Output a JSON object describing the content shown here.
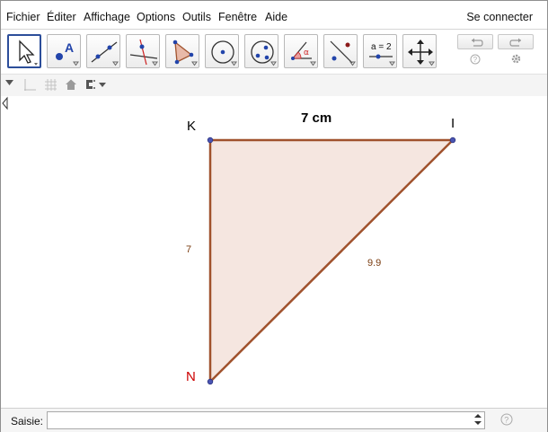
{
  "menu": {
    "items": [
      "Fichier",
      "Éditer",
      "Affichage",
      "Options",
      "Outils",
      "Fenêtre",
      "Aide"
    ],
    "login": "Se connecter"
  },
  "toolbar": {
    "tools": [
      {
        "name": "move-tool-icon",
        "selected": true
      },
      {
        "name": "point-tool-icon"
      },
      {
        "name": "line-tool-icon"
      },
      {
        "name": "perpendicular-line-tool-icon"
      },
      {
        "name": "polygon-tool-icon"
      },
      {
        "name": "circle-tool-icon"
      },
      {
        "name": "conic-tool-icon"
      },
      {
        "name": "angle-tool-icon"
      },
      {
        "name": "reflect-tool-icon"
      },
      {
        "name": "slider-tool-icon",
        "text": "a = 2"
      },
      {
        "name": "move-graphics-view-tool-icon"
      }
    ],
    "undo_icon": "undo-icon",
    "redo_icon": "redo-icon",
    "help_icon": "help-icon",
    "settings_icon": "gear-icon"
  },
  "graphics": {
    "title": "7 cm",
    "points": {
      "K": "K",
      "I": "I",
      "N": "N"
    },
    "segments": {
      "KN": "7",
      "NI": "9.9"
    },
    "colors": {
      "polygon_fill": "#f5e6e0",
      "polygon_stroke": "#a0522d",
      "point_fill": "#4b55b3",
      "label_N": "#cc0000"
    }
  },
  "inputbar": {
    "label": "Saisie:",
    "value": "",
    "placeholder": ""
  }
}
